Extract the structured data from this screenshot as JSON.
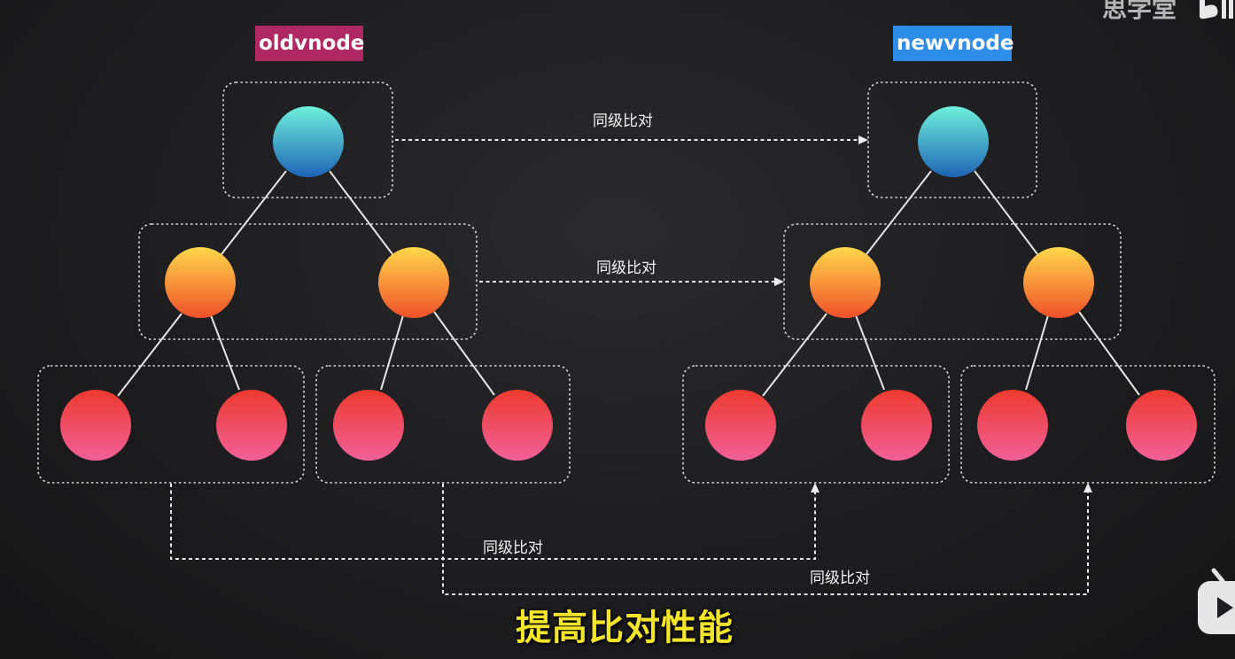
{
  "labels": {
    "old_tree": "oldvnode",
    "new_tree": "newvnode",
    "compare_root": "同级比对",
    "compare_level2": "同级比对",
    "compare_left_leaves": "同级比对",
    "compare_right_leaves": "同级比对"
  },
  "subtitle": "提高比对性能",
  "watermark": "思学堂",
  "colors": {
    "old_tag": "#b02863",
    "new_tag": "#2e8de8",
    "root_node": [
      "#6ff0dc",
      "#1e64b4"
    ],
    "middle_node": [
      "#ffd84a",
      "#f0502a"
    ],
    "leaf_node": [
      "#ee3a2e",
      "#f0609a"
    ],
    "subtitle": "#f5e52a"
  },
  "icons": {
    "corner_logo": "bilibili-logo",
    "bottom_right": "bilibili-tv-icon"
  }
}
